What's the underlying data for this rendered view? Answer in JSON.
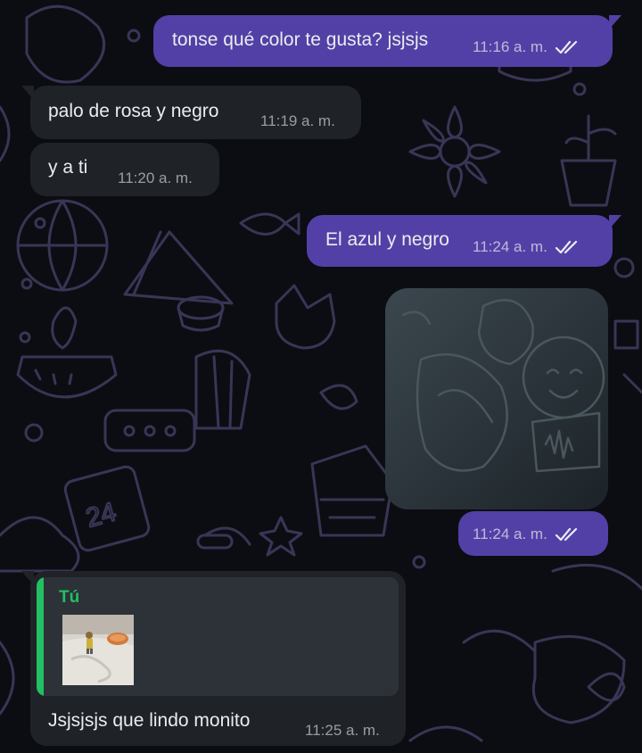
{
  "colors": {
    "outgoing_bubble": "#5340a6",
    "incoming_bubble": "#1f2328",
    "background": "#0b0d12",
    "quote_accent": "#21c063",
    "wallpaper_doodles": "#3a3556"
  },
  "messages": [
    {
      "direction": "outgoing",
      "text": "tonse qué color te gusta? jsjsjs",
      "time": "11:16 a. m.",
      "status": "read",
      "status_icon": "double-check-icon"
    },
    {
      "direction": "incoming",
      "text": "palo de rosa y negro",
      "time": "11:19 a. m."
    },
    {
      "direction": "incoming",
      "text": "y a ti",
      "time": "11:20 a. m."
    },
    {
      "direction": "outgoing",
      "text": "El azul y negro",
      "time": "11:24 a. m.",
      "status": "read",
      "status_icon": "double-check-icon"
    },
    {
      "direction": "outgoing",
      "type": "sticker",
      "time": "11:24 a. m.",
      "status": "read",
      "status_icon": "double-check-icon"
    },
    {
      "direction": "incoming",
      "reply_to": {
        "author": "Tú",
        "media": "photo"
      },
      "text": "Jsjsjsjs que lindo monito",
      "time": "11:25 a. m."
    }
  ]
}
